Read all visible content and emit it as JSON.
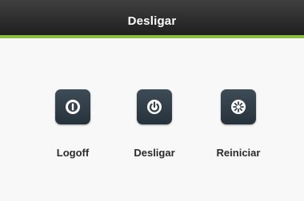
{
  "window": {
    "title": "Desligar"
  },
  "actions": [
    {
      "label": "Logoff",
      "icon": "logoff-icon"
    },
    {
      "label": "Desligar",
      "icon": "power-icon"
    },
    {
      "label": "Reiniciar",
      "icon": "restart-icon"
    }
  ],
  "colors": {
    "title_bar": "#2b2b2b",
    "accent": "#8cbf3f",
    "tile": "#34414b",
    "label": "#2a2a2a"
  }
}
